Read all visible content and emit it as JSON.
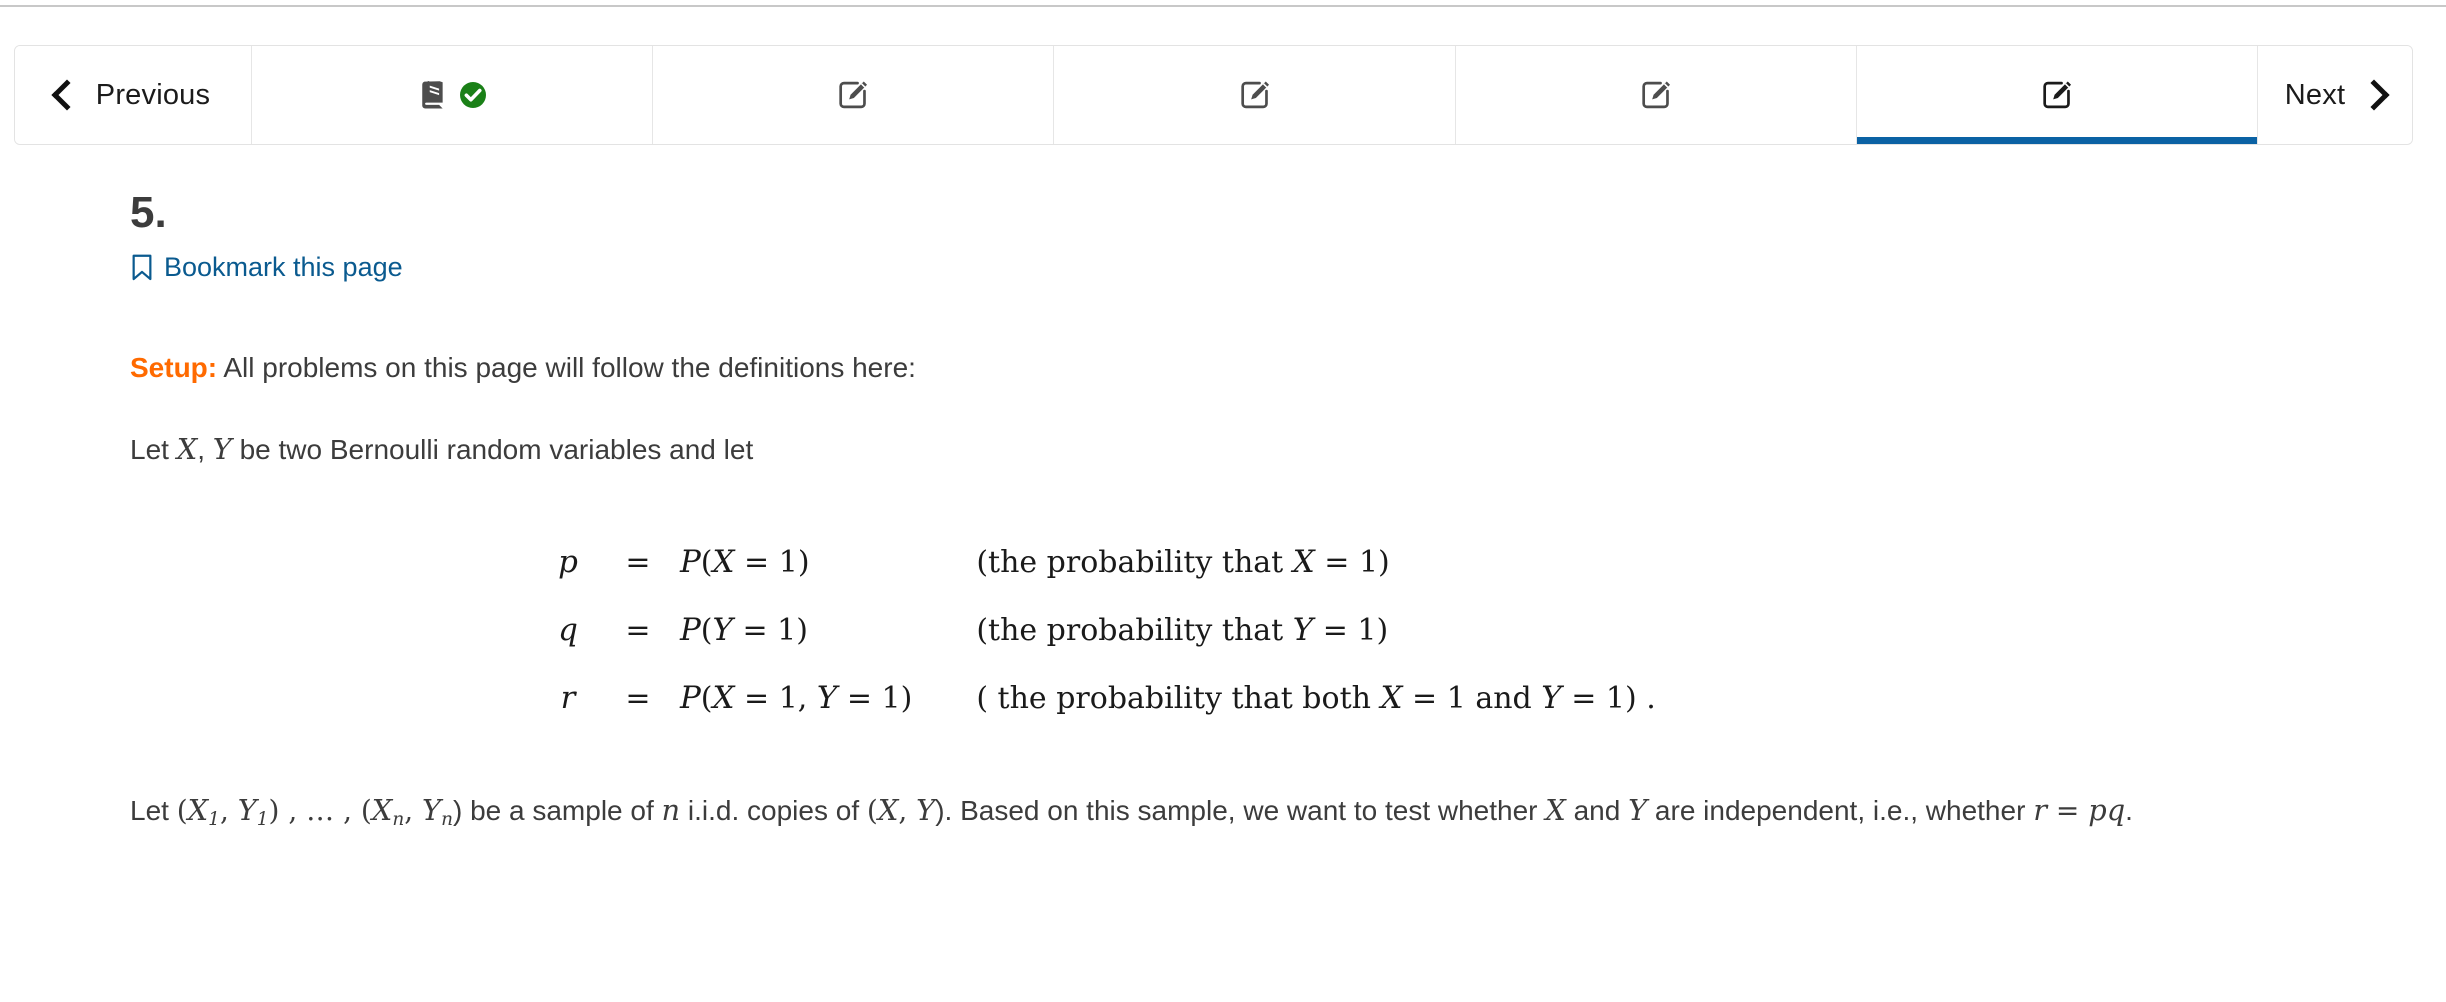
{
  "nav": {
    "previous_label": "Previous",
    "next_label": "Next",
    "prev_icon": "chevron-left-icon",
    "next_icon": "chevron-right-icon",
    "tabs": [
      {
        "icon": "book-icon",
        "status_icon": "check-circle-icon",
        "active": false,
        "completed": true
      },
      {
        "icon": "pencil-square-icon",
        "active": false,
        "completed": false
      },
      {
        "icon": "pencil-square-icon",
        "active": false,
        "completed": false
      },
      {
        "icon": "pencil-square-icon",
        "active": false,
        "completed": false
      },
      {
        "icon": "pencil-square-icon",
        "active": true,
        "completed": false
      }
    ]
  },
  "page": {
    "title": "5.",
    "bookmark_label": "Bookmark this page",
    "bookmark_icon": "bookmark-icon"
  },
  "body": {
    "setup_keyword": "Setup:",
    "setup_text": " All problems on this page will follow the definitions here:",
    "let_line": {
      "pre": "Let ",
      "var_x": "X",
      "comma": ", ",
      "var_y": "Y",
      "post": " be two Bernoulli random variables and let"
    },
    "equations": [
      {
        "lhs": "p",
        "eq": "=",
        "rhs_fn": "P",
        "rhs_open": "(",
        "rhs_var": "X",
        "rhs_eq": " = 1",
        "rhs_close": ")",
        "note_pre": "(the probability that ",
        "note_var": "X",
        "note_post": " = 1)"
      },
      {
        "lhs": "q",
        "eq": "=",
        "rhs_fn": "P",
        "rhs_open": "(",
        "rhs_var": "Y",
        "rhs_eq": " = 1",
        "rhs_close": ")",
        "note_pre": "(the probability that ",
        "note_var": "Y",
        "note_post": " = 1)"
      },
      {
        "lhs": "r",
        "eq": "=",
        "rhs_fn": "P",
        "rhs_open": "(",
        "rhs_var": "X",
        "rhs_eq": " = 1, ",
        "rhs_var2": "Y",
        "rhs_eq2": " = 1",
        "rhs_close": ")",
        "note_pre": "( the probability that both ",
        "note_var": "X",
        "note_mid": " = 1 and ",
        "note_var2": "Y",
        "note_post": " = 1) ."
      }
    ],
    "sample_line": {
      "t1": "Let ",
      "t2": "(",
      "x1": "X",
      "x1sub": "1",
      "t3": ", ",
      "y1": "Y",
      "y1sub": "1",
      "t4": ") , … , (",
      "xn": "X",
      "xnsub": "n",
      "t5": ", ",
      "yn": "Y",
      "ynsub": "n",
      "t6": ") be a sample of ",
      "n": "n",
      "t7": " i.i.d. copies of ",
      "t8": "(",
      "x": "X",
      "t9": ", ",
      "y": "Y",
      "t10": "). Based on this sample, we want to test whether ",
      "x2": "X",
      "t11": " and ",
      "y2": "Y",
      "t12": " are independent, i.e., whether ",
      "r": "r",
      "t13": " = ",
      "pq": "pq",
      "t14": "."
    }
  },
  "colors": {
    "accent_blue": "#0b62a4",
    "link_blue": "#0a5a8f",
    "setup_orange": "#ff6a00",
    "check_green": "#1a8017",
    "icon_gray": "#4d4d4d",
    "border_gray": "#e3e3e3",
    "text_gray": "#3c3c3c"
  }
}
